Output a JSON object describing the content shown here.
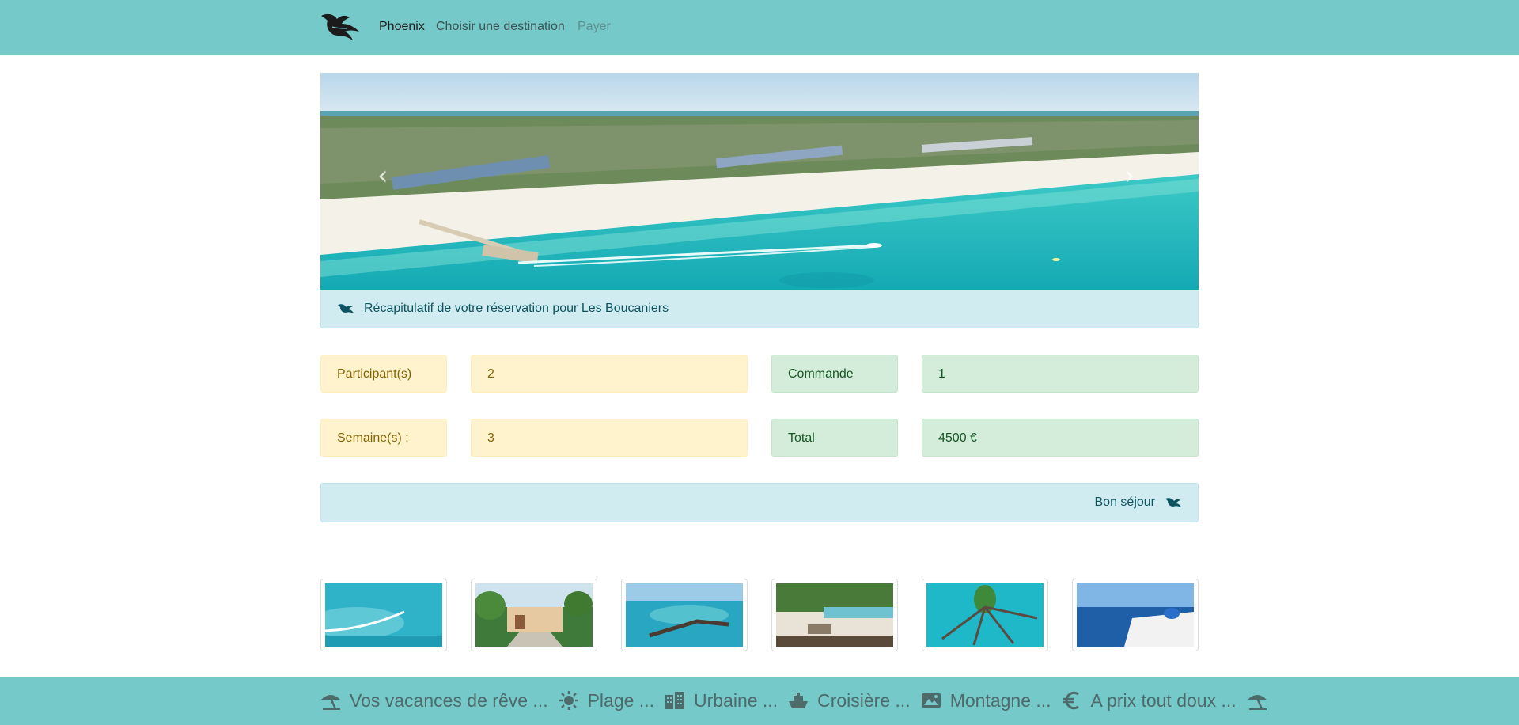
{
  "nav": {
    "brand": "Phoenix",
    "choose_destination": "Choisir une destination",
    "pay": "Payer"
  },
  "colors": {
    "navbar": "#76c9c9",
    "info": "#d1ecf1",
    "warning": "#fff3cd",
    "success": "#d4edda"
  },
  "summary": {
    "title": "Récapitulatif de votre réservation pour Les Boucaniers",
    "icon": "phoenix-bird-icon"
  },
  "booking": {
    "participants_label": "Participant(s)",
    "participants_value": "2",
    "order_label": "Commande",
    "order_value": "1",
    "weeks_label": "Semaine(s) :",
    "weeks_value": "3",
    "total_label": "Total",
    "total_value": "4500 €"
  },
  "farewell": {
    "text": "Bon séjour",
    "icon": "phoenix-bird-icon"
  },
  "gallery": {
    "thumbnails": [
      "lagoon-pier",
      "garden-villa",
      "overwater-villas",
      "beach-lounge",
      "island-resort",
      "santorini"
    ]
  },
  "footer": {
    "items": [
      {
        "icon": "beach-umbrella-icon",
        "label": "Vos vacances de rêve ..."
      },
      {
        "icon": "sun-icon",
        "label": "Plage ..."
      },
      {
        "icon": "city-icon",
        "label": "Urbaine ..."
      },
      {
        "icon": "ship-icon",
        "label": "Croisière ..."
      },
      {
        "icon": "image-icon",
        "label": "Montagne ..."
      },
      {
        "icon": "euro-icon",
        "label": "A prix tout doux ..."
      }
    ],
    "trailing_icon": "beach-umbrella-icon"
  }
}
